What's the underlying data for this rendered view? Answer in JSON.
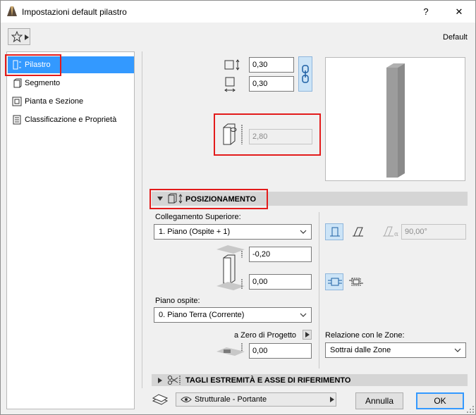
{
  "window": {
    "title": "Impostazioni default pilastro",
    "help_label": "?",
    "close_label": "✕"
  },
  "header": {
    "favorites_icon": "star-icon",
    "preset_label": "Default"
  },
  "sidebar": {
    "items": [
      {
        "label": "Pilastro",
        "icon": "column-icon",
        "selected": true
      },
      {
        "label": "Segmento",
        "icon": "segment-icon",
        "selected": false
      },
      {
        "label": "Pianta e Sezione",
        "icon": "plan-section-icon",
        "selected": false
      },
      {
        "label": "Classificazione e Proprietà",
        "icon": "classification-icon",
        "selected": false
      }
    ]
  },
  "dimensions": {
    "width_value": "0,30",
    "depth_value": "0,30",
    "height_value": "2,80"
  },
  "positioning": {
    "section_title": "POSIZIONAMENTO",
    "top_link_label": "Collegamento Superiore:",
    "top_link_value": "1. Piano (Ospite + 1)",
    "top_offset_value": "-0,20",
    "bottom_offset_value": "0,00",
    "home_story_label": "Piano ospite:",
    "home_story_value": "0. Piano Terra (Corrente)",
    "project_zero_label": "a Zero di Progetto",
    "project_zero_value": "0,00",
    "slant_angle_value": "90,00°",
    "zone_relation_label": "Relazione con le Zone:",
    "zone_relation_value": "Sottrai dalle Zone"
  },
  "cut_section": {
    "title": "TAGLI ESTREMITÀ E ASSE DI RIFERIMENTO"
  },
  "footer": {
    "structural_value": "Strutturale - Portante",
    "cancel_label": "Annulla",
    "ok_label": "OK"
  },
  "colors": {
    "selection": "#3399ff",
    "highlight_box": "#e31b1b",
    "toggle_active": "#cce4f7"
  }
}
